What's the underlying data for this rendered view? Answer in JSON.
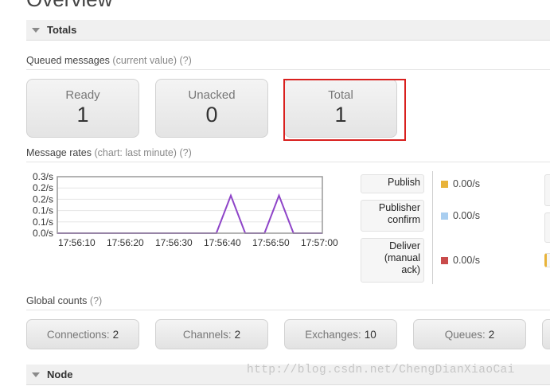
{
  "page": {
    "title": "Overview"
  },
  "totals": {
    "header": "Totals",
    "queued_label": "Queued messages",
    "queued_hint": "(current value)",
    "queued_help": "(?)",
    "stats": [
      {
        "label": "Ready",
        "value": "1"
      },
      {
        "label": "Unacked",
        "value": "0"
      },
      {
        "label": "Total",
        "value": "1"
      }
    ]
  },
  "rates": {
    "label": "Message rates",
    "hint": "(chart: last minute)",
    "help": "(?)",
    "legend": [
      {
        "label": "Publish",
        "rate": "0.00/s",
        "color": "#e8b33a"
      },
      {
        "label": "Publisher confirm",
        "rate": "0.00/s",
        "color": "#a9cef0"
      },
      {
        "label": "Deliver (manual ack)",
        "rate": "0.00/s",
        "color": "#c94b4b"
      }
    ]
  },
  "chart_data": {
    "type": "line",
    "x": [
      "17:56:10",
      "17:56:20",
      "17:56:30",
      "17:56:40",
      "17:56:50",
      "17:57:00"
    ],
    "yticks": [
      "0.0/s",
      "0.1/s",
      "0.1/s",
      "0.2/s",
      "0.2/s",
      "0.3/s"
    ],
    "ylim": [
      0,
      0.3
    ],
    "grid": true,
    "series": [
      {
        "color": "#8e44c8",
        "points": [
          [
            0,
            0
          ],
          [
            30,
            0
          ],
          [
            33,
            0
          ],
          [
            36,
            0.2
          ],
          [
            39,
            0
          ],
          [
            43,
            0
          ],
          [
            46,
            0.2
          ],
          [
            49,
            0
          ],
          [
            55,
            0
          ]
        ]
      }
    ]
  },
  "global_counts": {
    "label": "Global counts",
    "help": "(?)",
    "items": [
      {
        "label": "Connections:",
        "value": "2"
      },
      {
        "label": "Channels:",
        "value": "2"
      },
      {
        "label": "Exchanges:",
        "value": "10"
      },
      {
        "label": "Queues:",
        "value": "2"
      }
    ]
  },
  "node": {
    "header": "Node"
  },
  "watermark": "http://blog.csdn.net/ChengDianXiaoCai"
}
